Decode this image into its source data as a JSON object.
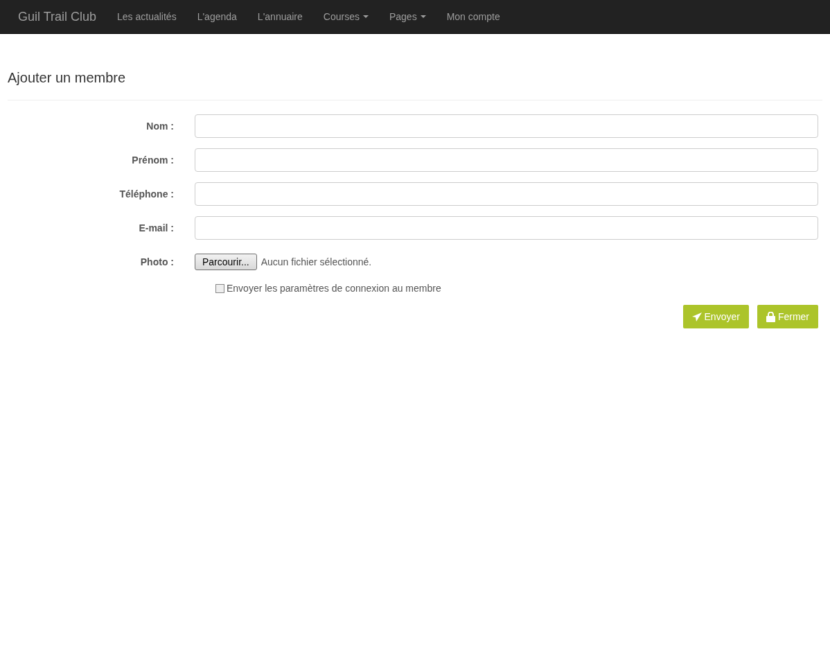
{
  "navbar": {
    "brand": "Guil Trail Club",
    "items": [
      {
        "label": "Les actualités",
        "dropdown": false
      },
      {
        "label": "L'agenda",
        "dropdown": false
      },
      {
        "label": "L'annuaire",
        "dropdown": false
      },
      {
        "label": "Courses",
        "dropdown": true
      },
      {
        "label": "Pages",
        "dropdown": true
      },
      {
        "label": "Mon compte",
        "dropdown": false
      }
    ]
  },
  "title": "Ajouter un membre",
  "fields": [
    {
      "kind": "text",
      "label": "Nom :"
    },
    {
      "kind": "text",
      "label": "Prénom :"
    },
    {
      "kind": "text",
      "label": "Téléphone :"
    },
    {
      "kind": "text",
      "label": "E-mail :"
    },
    {
      "kind": "file",
      "label": "Photo :",
      "button": "Parcourir...",
      "status": "Aucun fichier sélectionné."
    }
  ],
  "checkbox": {
    "label": "Envoyer les paramètres de connexion au membre",
    "checked": false
  },
  "buttons": [
    {
      "kind": "send",
      "label": "Envoyer"
    },
    {
      "kind": "close",
      "label": "Fermer"
    }
  ]
}
